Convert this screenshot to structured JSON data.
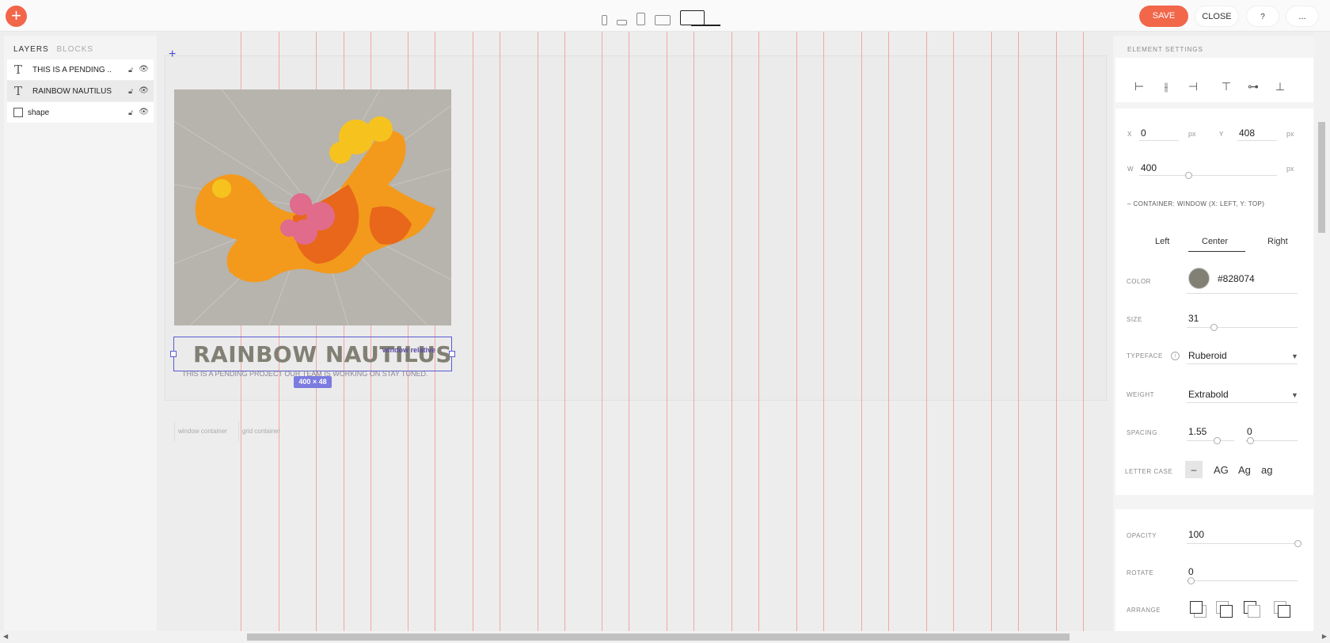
{
  "toolbar": {
    "add_label": "+",
    "save_label": "SAVE",
    "close_label": "CLOSE",
    "help_label": "?",
    "more_label": "..."
  },
  "layers": {
    "tab_layers": "LAYERS",
    "tab_blocks": "BLOCKS",
    "items": [
      {
        "name": "THIS IS A PENDING ...",
        "type": "text"
      },
      {
        "name": "RAINBOW NAUTILUS",
        "type": "text"
      },
      {
        "name": "shape",
        "type": "shape"
      }
    ]
  },
  "canvas": {
    "title": "RAINBOW NAUTILUS",
    "relative_label": "window relative",
    "subtitle": "THIS IS A PENDING PROJECT OUR TEAM IS WORKING ON STAY TUNED.",
    "dimensions": "400 × 48",
    "container_labels": [
      "window container",
      "grid container"
    ]
  },
  "settings": {
    "title": "ELEMENT SETTINGS",
    "x_label": "X",
    "x_value": "0",
    "x_unit": "px",
    "y_label": "Y",
    "y_value": "408",
    "y_unit": "px",
    "w_label": "W",
    "w_value": "400",
    "w_unit": "px",
    "container_note": "– CONTAINER: WINDOW (X: LEFT, Y: TOP)",
    "align_left": "Left",
    "align_center": "Center",
    "align_right": "Right",
    "color_label": "COLOR",
    "color_value": "#828074",
    "size_label": "SIZE",
    "size_value": "31",
    "typeface_label": "TYPEFACE",
    "typeface_value": "Ruberoid",
    "weight_label": "WEIGHT",
    "weight_value": "Extrabold",
    "spacing_label": "SPACING",
    "spacing_value_1": "1.55",
    "spacing_value_2": "0",
    "letter_case_label": "LETTER CASE",
    "case_options": [
      "–",
      "AG",
      "Ag",
      "ag"
    ],
    "opacity_label": "OPACITY",
    "opacity_value": "100",
    "rotate_label": "ROTATE",
    "rotate_value": "0",
    "arrange_label": "ARRANGE"
  },
  "colors": {
    "accent": "#f26649",
    "selection": "#5a5ad6",
    "grid": "#f2a6a6",
    "text_color": "#828074"
  }
}
